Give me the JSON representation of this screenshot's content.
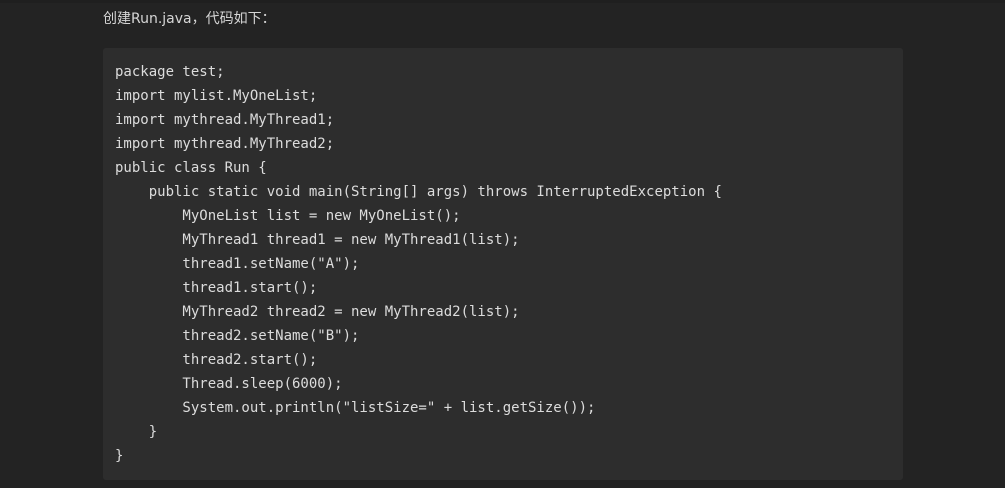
{
  "intro": {
    "text": "创建Run.java，代码如下："
  },
  "code": {
    "language": "java",
    "lines": [
      "package test;",
      "import mylist.MyOneList;",
      "import mythread.MyThread1;",
      "import mythread.MyThread2;",
      "public class Run {",
      "    public static void main(String[] args) throws InterruptedException {",
      "        MyOneList list = new MyOneList();",
      "        MyThread1 thread1 = new MyThread1(list);",
      "        thread1.setName(\"A\");",
      "        thread1.start();",
      "        MyThread2 thread2 = new MyThread2(list);",
      "        thread2.setName(\"B\");",
      "        thread2.start();",
      "        Thread.sleep(6000);",
      "        System.out.println(\"listSize=\" + list.getSize());",
      "    }",
      "}"
    ]
  },
  "colors": {
    "page_background": "#232323",
    "code_background": "#2d2d2d",
    "text": "#dcdcdc"
  }
}
